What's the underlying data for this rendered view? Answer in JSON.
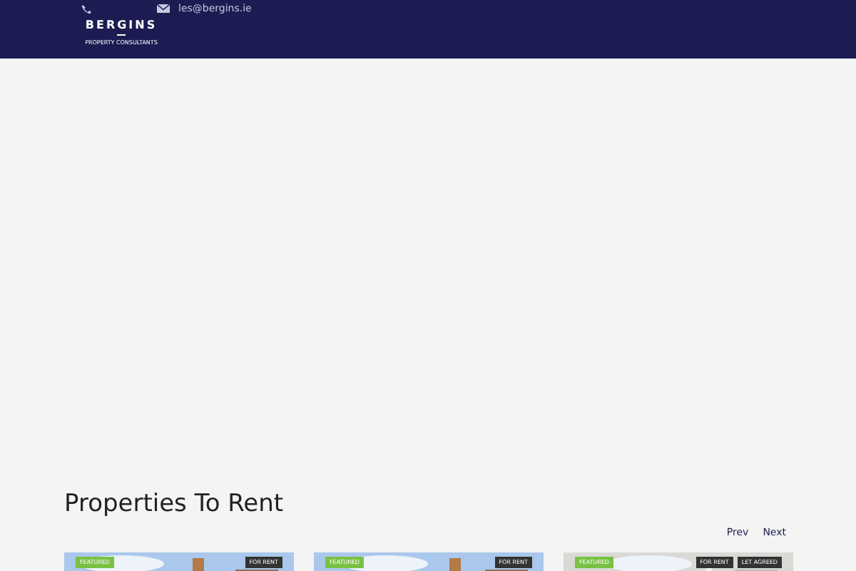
{
  "header": {
    "email": "les@bergins.ie",
    "logo": {
      "name": "BERGINS",
      "tagline": "PROPERTY CONSULTANTS"
    }
  },
  "section": {
    "title": "Properties To Rent",
    "pager": [
      "Prev",
      "Next"
    ]
  },
  "cards": [
    {
      "kind": "picture",
      "badges": [
        {
          "label": "FEATURED",
          "kind": "featured"
        },
        {
          "label": "FOR RENT",
          "kind": "status"
        }
      ]
    },
    {
      "kind": "picture",
      "badges": [
        {
          "label": "FEATURED",
          "kind": "featured"
        },
        {
          "label": "FOR RENT",
          "kind": "status"
        }
      ]
    },
    {
      "kind": "picture",
      "badges": [
        {
          "label": "FEATURED",
          "kind": "featured"
        },
        {
          "label": "FOR RENT",
          "kind": "status"
        },
        {
          "label": "LET AGREED",
          "kind": "status"
        }
      ]
    }
  ]
}
